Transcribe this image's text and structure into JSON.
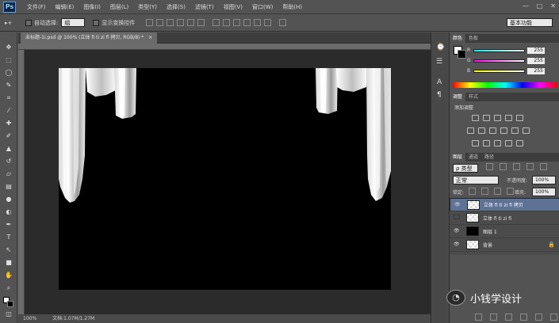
{
  "app": {
    "logo": "Ps"
  },
  "menu": [
    "文件(F)",
    "编辑(E)",
    "图像(I)",
    "图层(L)",
    "类型(Y)",
    "选择(S)",
    "滤镜(T)",
    "视图(V)",
    "窗口(W)",
    "帮助(H)"
  ],
  "window_controls": {
    "minimize": "—",
    "maximize": "□",
    "close": "✕"
  },
  "options_bar": {
    "move_tool_label": "▸+",
    "auto_select_label": "自动选择:",
    "auto_select_value": "组",
    "show_transform_label": "显示变换控件",
    "workspace": "基本功能"
  },
  "document": {
    "tab_title": "未标题-1i.psd @ 100% (立体 fi  ti  zi  fi 拷贝, RGB/8) *",
    "tab_close": "×",
    "zoom": "100%",
    "doc_info": "文档:1.07M/1.27M"
  },
  "color_panel": {
    "tabs": [
      "颜色",
      "色板"
    ],
    "channels": [
      {
        "label": "R",
        "value": "255"
      },
      {
        "label": "G",
        "value": "255"
      },
      {
        "label": "B",
        "value": "255"
      }
    ]
  },
  "adjustments_panel": {
    "tabs": [
      "调整",
      "样式"
    ],
    "heading": "添加调整"
  },
  "layers_panel": {
    "tabs": [
      "图层",
      "通道",
      "路径"
    ],
    "kind_filter": "ρ 类型",
    "blend_mode": "正常",
    "opacity_label": "不透明度:",
    "opacity_value": "100%",
    "lock_label": "锁定:",
    "fill_label": "填充:",
    "fill_value": "100%",
    "layers": [
      {
        "name": "立体 fi  ti  zi  fi 拷贝",
        "visible": true,
        "selected": true,
        "thumb": "transparent"
      },
      {
        "name": "立体 fi  ti  zi  fi",
        "visible": false,
        "selected": false,
        "thumb": "transparent"
      },
      {
        "name": "图层 1",
        "visible": true,
        "selected": false,
        "thumb": "black"
      },
      {
        "name": "背景",
        "visible": true,
        "selected": false,
        "thumb": "transparent",
        "locked": true
      }
    ],
    "footer_icons": [
      "link-icon",
      "fx-icon",
      "mask-icon",
      "adjustment-icon",
      "group-icon",
      "new-layer-icon",
      "trash-icon"
    ]
  },
  "watermark": {
    "text": "小钱学设计"
  }
}
